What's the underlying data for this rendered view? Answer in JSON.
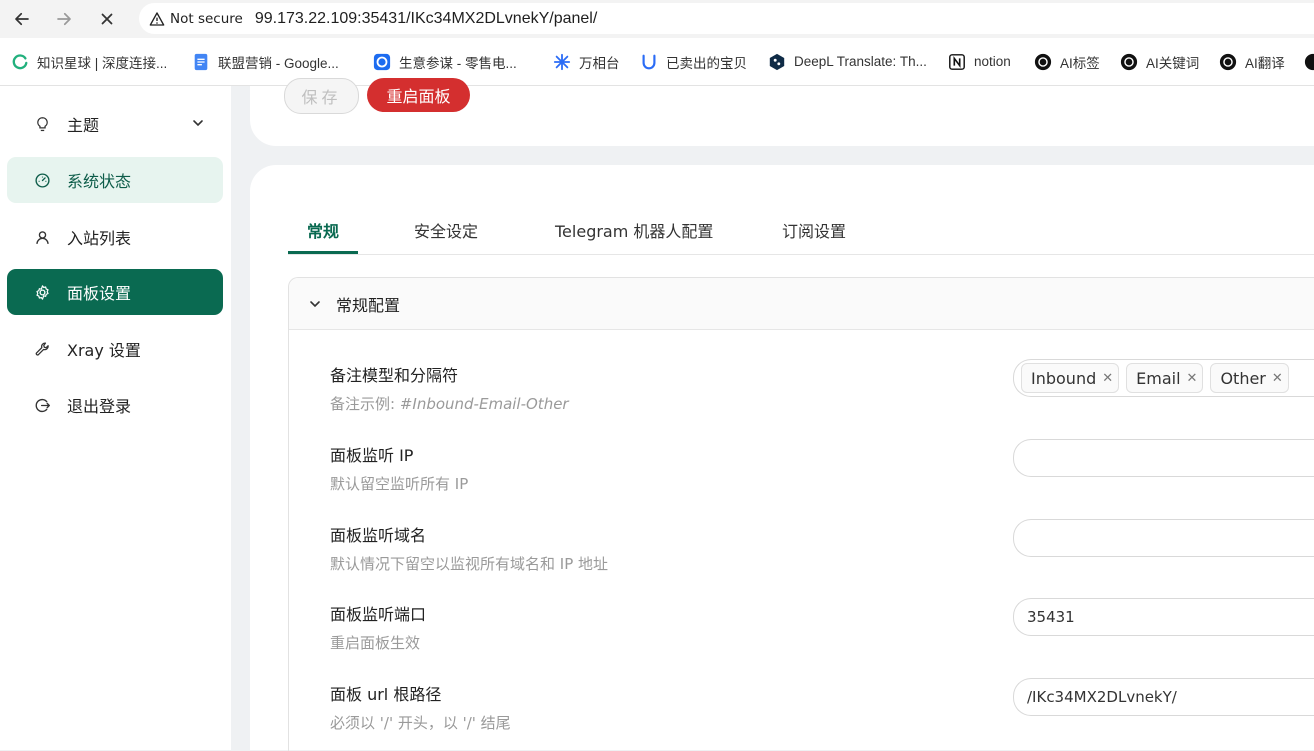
{
  "browser": {
    "security_label": "Not secure",
    "url": "99.173.22.109:35431/IKc34MX2DLvnekY/panel/",
    "bookmarks": [
      {
        "label": "知识星球 | 深度连接...",
        "icon": "zsxq-icon"
      },
      {
        "label": "联盟营销 - Google...",
        "icon": "google-docs-icon"
      },
      {
        "label": "生意参谋 - 零售电...",
        "icon": "shengyi-icon"
      },
      {
        "label": "万相台",
        "icon": "wanxiang-icon"
      },
      {
        "label": "已卖出的宝贝",
        "icon": "taobao-icon"
      },
      {
        "label": "DeepL Translate: Th...",
        "icon": "deepl-icon"
      },
      {
        "label": "notion",
        "icon": "notion-icon"
      },
      {
        "label": "AI标签",
        "icon": "openai-icon"
      },
      {
        "label": "AI关键词",
        "icon": "openai-icon"
      },
      {
        "label": "AI翻译",
        "icon": "openai-icon"
      }
    ]
  },
  "sidebar": {
    "items": [
      {
        "label": "主题",
        "icon": "bulb-icon"
      },
      {
        "label": "系统状态",
        "icon": "dashboard-icon"
      },
      {
        "label": "入站列表",
        "icon": "user-icon"
      },
      {
        "label": "面板设置",
        "icon": "gear-icon"
      },
      {
        "label": "Xray 设置",
        "icon": "wrench-icon"
      },
      {
        "label": "退出登录",
        "icon": "logout-icon"
      }
    ]
  },
  "toolbar": {
    "save_label": "保存",
    "restart_label": "重启面板"
  },
  "tabs": [
    {
      "label": "常规"
    },
    {
      "label": "安全设定"
    },
    {
      "label": "Telegram 机器人配置"
    },
    {
      "label": "订阅设置"
    }
  ],
  "section": {
    "title": "常规配置",
    "rows": [
      {
        "label": "备注模型和分隔符",
        "desc_prefix": "备注示例: ",
        "desc_example": "#Inbound-Email-Other",
        "tags": [
          "Inbound",
          "Email",
          "Other"
        ]
      },
      {
        "label": "面板监听 IP",
        "desc": "默认留空监听所有 IP",
        "value": ""
      },
      {
        "label": "面板监听域名",
        "desc": "默认情况下留空以监视所有域名和 IP 地址",
        "value": ""
      },
      {
        "label": "面板监听端口",
        "desc": "重启面板生效",
        "value": "35431"
      },
      {
        "label": "面板 url 根路径",
        "desc": "必须以 '/' 开头，以 '/' 结尾",
        "value": "/IKc34MX2DLvnekY/"
      }
    ]
  },
  "colors": {
    "accent": "#0a6a51",
    "danger": "#d42f2f",
    "selected_light": "#e7f4ef"
  }
}
